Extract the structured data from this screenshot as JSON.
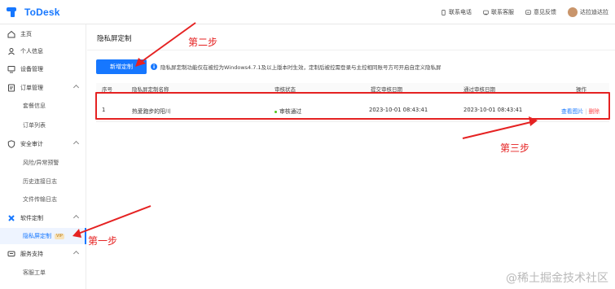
{
  "header": {
    "logo_text": "ToDesk",
    "items": [
      {
        "label": "联系电话",
        "icon": "phone-icon"
      },
      {
        "label": "联系客服",
        "icon": "service-icon"
      },
      {
        "label": "意见反馈",
        "icon": "feedback-icon"
      }
    ],
    "user_name": "达拉迪达拉"
  },
  "sidebar": {
    "items": [
      {
        "label": "主页",
        "icon": "home-icon"
      },
      {
        "label": "个人信息",
        "icon": "user-icon"
      },
      {
        "label": "设备管理",
        "icon": "device-icon"
      },
      {
        "label": "订单管理",
        "icon": "order-icon"
      },
      {
        "label": "套餐信息"
      },
      {
        "label": "订单列表"
      },
      {
        "label": "安全审计",
        "icon": "shield-icon"
      },
      {
        "label": "风险/异常预警"
      },
      {
        "label": "历史连接日志"
      },
      {
        "label": "文件传输日志"
      },
      {
        "label": "软件定制",
        "icon": "puzzle-icon"
      },
      {
        "label": "隐私屏定制",
        "badge": "VIP"
      },
      {
        "label": "服务支持",
        "icon": "support-icon"
      },
      {
        "label": "客服工单"
      }
    ]
  },
  "main": {
    "title": "隐私屏定制",
    "new_button": "新增定制",
    "notice": "隐私屏定制功能仅在被控为Windows4.7.1及以上版本时生效，定制后被控需登录与主控相同账号方可开启自定义隐私屏",
    "table": {
      "headers": [
        "序号",
        "隐私屏定制名称",
        "审核状态",
        "提交审核日期",
        "通过审核日期",
        "操作"
      ],
      "rows": [
        {
          "index": "1",
          "name": "热爱跑步的阳川",
          "status": "审核通过",
          "submit_date": "2023-10-01 08:43:41",
          "approve_date": "2023-10-01 08:43:41",
          "action_view": "查看图片",
          "action_delete": "删除"
        }
      ]
    }
  },
  "annotations": {
    "step1": "第一步",
    "step2": "第二步",
    "step3": "第三步",
    "color": "#e52222"
  },
  "watermark": "@稀土掘金技术社区"
}
